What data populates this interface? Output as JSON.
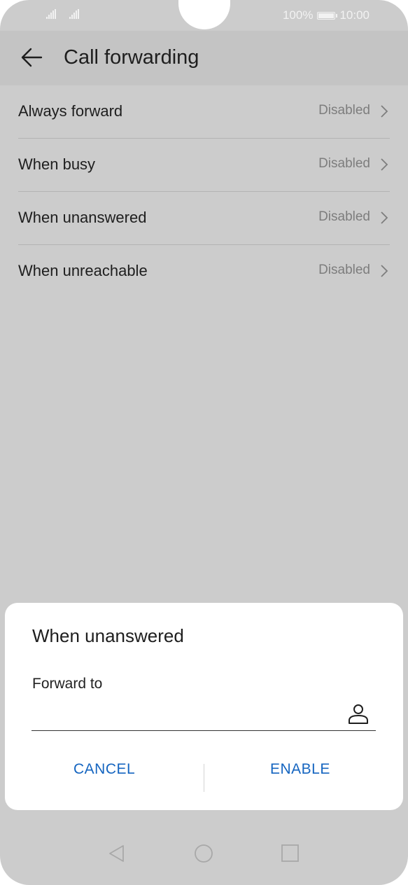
{
  "status_bar": {
    "battery": "100%",
    "time": "10:00"
  },
  "app_bar": {
    "title": "Call forwarding"
  },
  "forwarding_options": [
    {
      "label": "Always forward",
      "status": "Disabled"
    },
    {
      "label": "When busy",
      "status": "Disabled"
    },
    {
      "label": "When unanswered",
      "status": "Disabled"
    },
    {
      "label": "When unreachable",
      "status": "Disabled"
    }
  ],
  "dialog": {
    "title": "When unanswered",
    "field_label": "Forward to",
    "field_value": "",
    "cancel_label": "CANCEL",
    "enable_label": "ENABLE"
  },
  "colors": {
    "accent": "#1565c0",
    "background_dim": "#cccccc",
    "app_bar": "#c4c4c4"
  }
}
